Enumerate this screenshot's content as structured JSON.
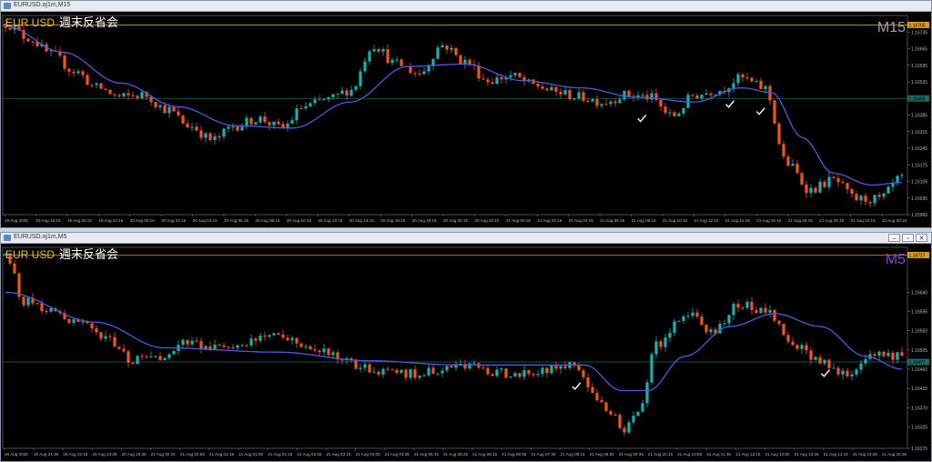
{
  "windows": [
    {
      "title": "EURUSD.oj1m,M15",
      "symbol_label": "EUR USD",
      "overlay_text": "週末反省会",
      "timeframe_label": "M15",
      "timeframe_color": "#9aa3ad",
      "hline_top_value": "1.16765",
      "hline_mid_value": "1.16455",
      "controls": []
    },
    {
      "title": "EURUSD.oj1m,M5",
      "symbol_label": "EUR USD",
      "overlay_text": "週末反省会",
      "timeframe_label": "M5",
      "timeframe_color": "#8e44c0",
      "hline_top_value": "1.16727",
      "hline_mid_value": "1.16477",
      "controls": [
        "–",
        "▫",
        "✕"
      ]
    }
  ],
  "colors": {
    "bull": "#18b0b0",
    "bear": "#f2541b",
    "ma": "#5058e0",
    "hline_top": "#d79e24",
    "hline_mid": "#1d6a66",
    "symbol_text": "#f0c020",
    "overlay_text": "#ffffff",
    "checkmark": "#ffffff",
    "tick_text": "#b8b8b8"
  },
  "chart_data": [
    {
      "type": "candlestick",
      "title": "EURUSD.oj1m,M15",
      "ylim": [
        1.15965,
        1.16805
      ],
      "y_ticks": [
        1.16735,
        1.16665,
        1.16595,
        1.16525,
        1.16455,
        1.16385,
        1.16315,
        1.16245,
        1.16175,
        1.16105,
        1.16035,
        1.15965
      ],
      "x_ticks": [
        "19 Aug 2025",
        "19 Aug 18:15",
        "19 Aug 20:15",
        "19 Aug 22:15",
        "20 Aug 00:15",
        "20 Aug 02:15",
        "20 Aug 04:15",
        "20 Aug 06:15",
        "20 Aug 08:15",
        "20 Aug 10:15",
        "20 Aug 12:15",
        "20 Aug 14:15",
        "20 Aug 16:15",
        "20 Aug 18:15",
        "20 Aug 20:15",
        "20 Aug 22:15",
        "21 Aug 00:15",
        "21 Aug 02:15",
        "21 Aug 04:15",
        "21 Aug 06:15",
        "21 Aug 08:15",
        "21 Aug 10:15",
        "21 Aug 12:15",
        "21 Aug 14:15",
        "21 Aug 16:15",
        "21 Aug 18:15",
        "21 Aug 20:15",
        "21 Aug 22:15",
        "22 Aug 00:15"
      ],
      "hlines": [
        1.16765,
        1.16455
      ],
      "candle_count": 198,
      "anchors": [
        [
          0,
          1.1677
        ],
        [
          6,
          1.1671
        ],
        [
          12,
          1.1664
        ],
        [
          18,
          1.1657
        ],
        [
          24,
          1.165
        ],
        [
          30,
          1.1646
        ],
        [
          36,
          1.1647
        ],
        [
          42,
          1.1641
        ],
        [
          48,
          1.1634
        ],
        [
          54,
          1.1628
        ],
        [
          60,
          1.1634
        ],
        [
          66,
          1.1637
        ],
        [
          72,
          1.1633
        ],
        [
          78,
          1.1642
        ],
        [
          84,
          1.1645
        ],
        [
          90,
          1.1649
        ],
        [
          96,
          1.1668
        ],
        [
          102,
          1.166
        ],
        [
          108,
          1.1656
        ],
        [
          114,
          1.1668
        ],
        [
          120,
          1.1661
        ],
        [
          126,
          1.1653
        ],
        [
          132,
          1.1655
        ],
        [
          138,
          1.1651
        ],
        [
          144,
          1.1648
        ],
        [
          150,
          1.1646
        ],
        [
          156,
          1.1644
        ],
        [
          162,
          1.1647
        ],
        [
          168,
          1.1646
        ],
        [
          174,
          1.1638
        ],
        [
          180,
          1.1647
        ],
        [
          186,
          1.1649
        ],
        [
          192,
          1.1654
        ],
        [
          198,
          1.165
        ],
        [
          204,
          1.1618
        ],
        [
          210,
          1.1607
        ],
        [
          216,
          1.1611
        ],
        [
          222,
          1.1603
        ],
        [
          228,
          1.1603
        ],
        [
          234,
          1.1612
        ]
      ],
      "ma_anchors": [
        [
          0,
          1.1676
        ],
        [
          15,
          1.1665
        ],
        [
          30,
          1.1652
        ],
        [
          45,
          1.1642
        ],
        [
          60,
          1.1634
        ],
        [
          75,
          1.1633
        ],
        [
          90,
          1.1644
        ],
        [
          105,
          1.1659
        ],
        [
          120,
          1.166
        ],
        [
          135,
          1.1653
        ],
        [
          150,
          1.165
        ],
        [
          165,
          1.1646
        ],
        [
          180,
          1.1644
        ],
        [
          192,
          1.165
        ],
        [
          200,
          1.1648
        ],
        [
          208,
          1.1629
        ],
        [
          216,
          1.1614
        ],
        [
          226,
          1.1609
        ],
        [
          234,
          1.161
        ]
      ],
      "checkmarks": [
        [
          166,
          1.1637
        ],
        [
          189,
          1.1643
        ],
        [
          197,
          1.164
        ]
      ]
    },
    {
      "type": "candlestick",
      "title": "EURUSD.oj1m,M5",
      "ylim": [
        1.16275,
        1.16745
      ],
      "y_ticks": [
        1.16727,
        1.1664,
        1.16595,
        1.1655,
        1.16505,
        1.16477,
        1.1646,
        1.16415,
        1.1637,
        1.16325,
        1.16275
      ],
      "x_ticks": [
        "20 Aug 2025",
        "20 Aug 21:30",
        "20 Aug 22:15",
        "20 Aug 23:05",
        "20 Aug 23:35",
        "21 Aug 00:15",
        "21 Aug 00:55",
        "21 Aug 01:15",
        "21 Aug 01:55",
        "21 Aug 02:15",
        "21 Aug 02:55",
        "21 Aug 03:15",
        "21 Aug 04:05",
        "21 Aug 04:35",
        "21 Aug 05:15",
        "21 Aug 05:35",
        "21 Aug 06:15",
        "21 Aug 06:55",
        "21 Aug 07:35",
        "21 Aug 08:15",
        "21 Aug 08:55",
        "21 Aug 09:35",
        "21 Aug 10:15",
        "21 Aug 10:55",
        "21 Aug 11:35",
        "21 Aug 12:15",
        "21 Aug 12:55",
        "21 Aug 13:35",
        "21 Aug 14:15",
        "21 Aug 14:55",
        "21 Aug 15:35"
      ],
      "hlines": [
        1.16727,
        1.16477
      ],
      "candle_count": 198,
      "anchors": [
        [
          0,
          1.1673
        ],
        [
          4,
          1.1662
        ],
        [
          10,
          1.166
        ],
        [
          16,
          1.1657
        ],
        [
          22,
          1.1653
        ],
        [
          28,
          1.1648
        ],
        [
          34,
          1.1649
        ],
        [
          40,
          1.1652
        ],
        [
          50,
          1.1651
        ],
        [
          60,
          1.1654
        ],
        [
          70,
          1.165
        ],
        [
          80,
          1.1646
        ],
        [
          90,
          1.1645
        ],
        [
          100,
          1.1647
        ],
        [
          110,
          1.1645
        ],
        [
          120,
          1.1646
        ],
        [
          126,
          1.1647
        ],
        [
          130,
          1.164
        ],
        [
          134,
          1.1635
        ],
        [
          137,
          1.1632
        ],
        [
          140,
          1.1637
        ],
        [
          144,
          1.1652
        ],
        [
          150,
          1.1659
        ],
        [
          156,
          1.1655
        ],
        [
          162,
          1.1661
        ],
        [
          168,
          1.166
        ],
        [
          174,
          1.1652
        ],
        [
          180,
          1.1648
        ],
        [
          186,
          1.1645
        ],
        [
          192,
          1.165
        ],
        [
          198,
          1.1649
        ]
      ],
      "ma_anchors": [
        [
          0,
          1.1664
        ],
        [
          20,
          1.1657
        ],
        [
          35,
          1.1651
        ],
        [
          60,
          1.165
        ],
        [
          80,
          1.1648
        ],
        [
          100,
          1.1647
        ],
        [
          120,
          1.1647
        ],
        [
          128,
          1.1647
        ],
        [
          136,
          1.1641
        ],
        [
          142,
          1.1641
        ],
        [
          150,
          1.1649
        ],
        [
          160,
          1.1656
        ],
        [
          170,
          1.1659
        ],
        [
          180,
          1.1656
        ],
        [
          190,
          1.1649
        ],
        [
          198,
          1.1646
        ]
      ],
      "checkmarks": [
        [
          126,
          1.1642
        ],
        [
          181,
          1.1645
        ]
      ]
    }
  ]
}
